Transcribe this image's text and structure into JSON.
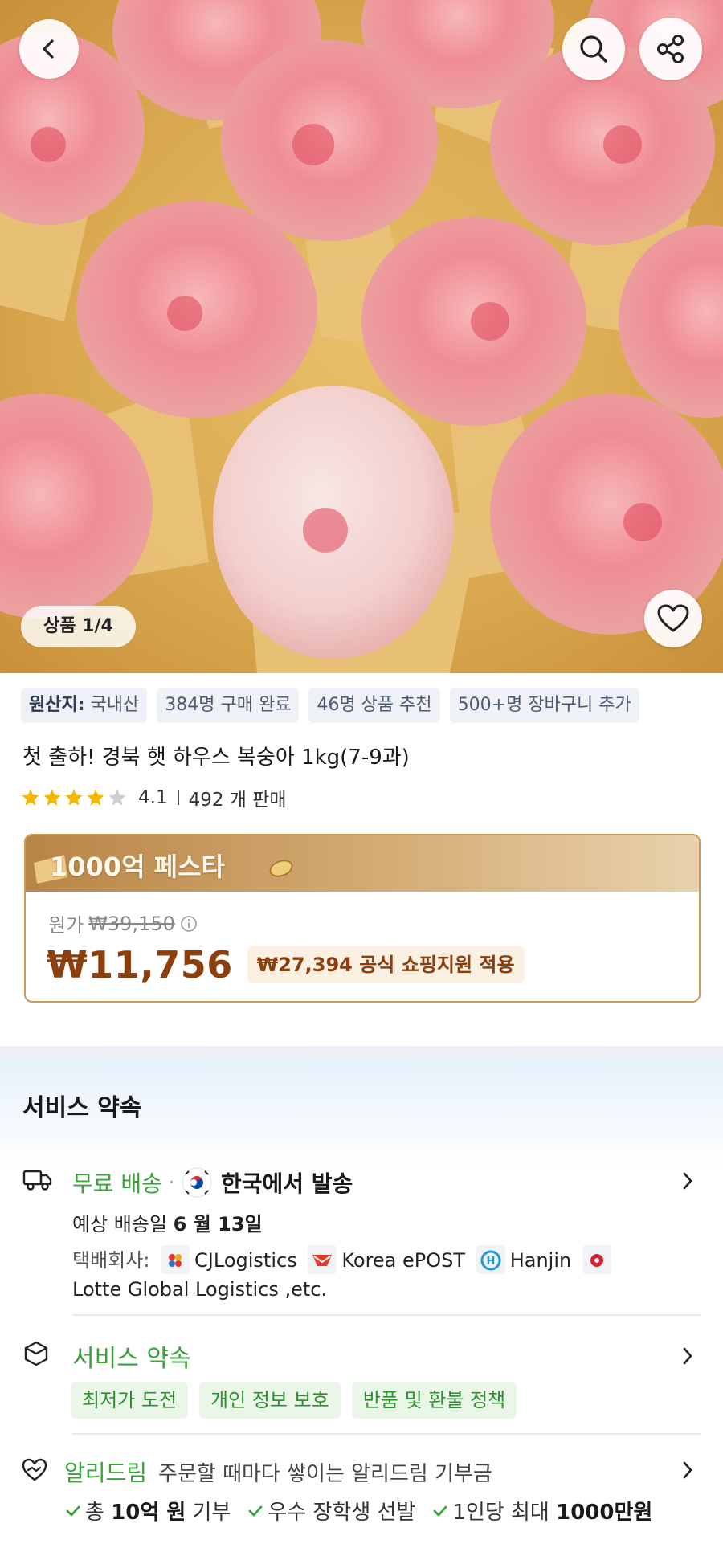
{
  "gallery": {
    "counter": "상품 1/4"
  },
  "tags": [
    {
      "label": "원산지:",
      "value": "국내산"
    },
    {
      "text": "384명 구매 완료"
    },
    {
      "text": "46명 상품 추천"
    },
    {
      "text": "500+명 장바구니 추가"
    }
  ],
  "product": {
    "title": "첫 출하! 경북 햇 하우스 복숭아 1kg(7-9과)",
    "rating": "4.1",
    "rating_stars": 4.1,
    "sold": "492 개 판매"
  },
  "price_card": {
    "banner": "1000억 페스타",
    "orig_label": "원가",
    "orig_price": "₩39,150",
    "price": "₩11,756",
    "support": "₩27,394 공식 쇼핑지원 적용"
  },
  "service": {
    "section_title": "서비스 약속",
    "shipping": {
      "free": "무료 배송",
      "dot": "·",
      "from": "한국에서 발송",
      "eta_label": "예상 배송일",
      "eta_value": "6 월 13일",
      "courier_label": "택배회사:",
      "couriers": [
        "CJLogistics",
        "Korea ePOST",
        "Hanjin"
      ],
      "couriers_more": "Lotte Global Logistics ,etc."
    },
    "promise": {
      "title": "서비스 약속",
      "chips": [
        "최저가 도전",
        "개인 정보 보호",
        "반품 및 환불 정책"
      ]
    },
    "alidream": {
      "title": "알리드림",
      "subtitle": "주문할 때마다 쌓이는 알리드림 기부금",
      "items": [
        {
          "pre": "총 ",
          "bold": "10억 원",
          "post": " 기부"
        },
        {
          "pre": "우수 장학생 선발",
          "bold": "",
          "post": ""
        },
        {
          "pre": "1인당 최대 ",
          "bold": "1000만원",
          "post": ""
        }
      ]
    }
  },
  "colors": {
    "accent_green": "#3aa23a",
    "price_brown": "#8a3f0c",
    "card_border": "#c99a5a"
  }
}
